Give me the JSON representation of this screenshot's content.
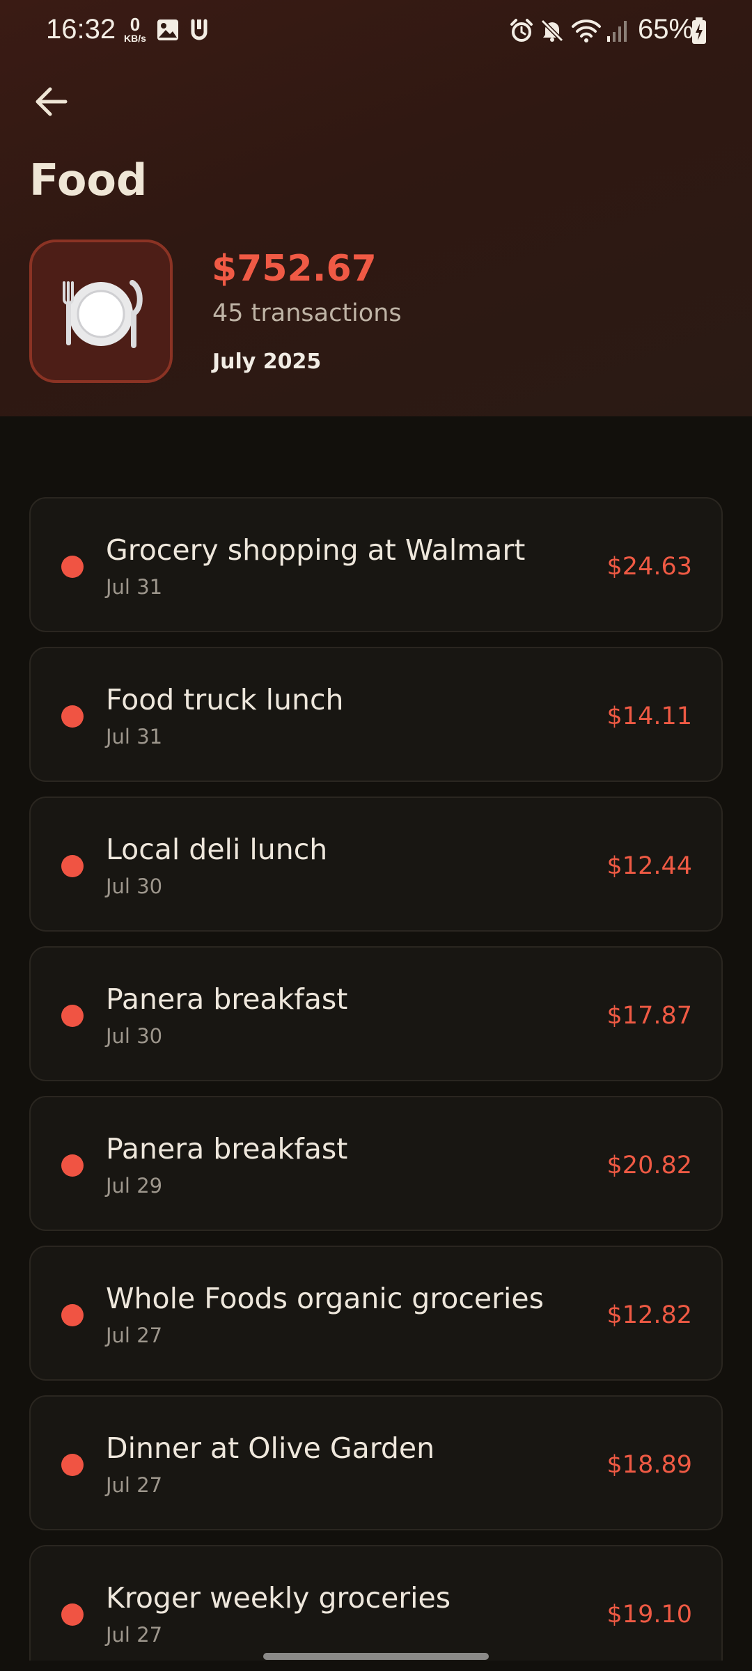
{
  "status_bar": {
    "time": "16:32",
    "net_speed_value": "0",
    "net_speed_unit": "KB/s",
    "battery": "65%",
    "icons": [
      "gallery-icon",
      "app-u-icon",
      "alarm-icon",
      "mute-icon",
      "wifi-icon",
      "signal-icon",
      "battery-charging-icon"
    ]
  },
  "header": {
    "back_icon": "arrow-left-icon",
    "title": "Food",
    "category_icon": "fork-knife-plate-icon",
    "total": "$752.67",
    "count": "45 transactions",
    "period": "July 2025"
  },
  "colors": {
    "accent_red": "#f05443",
    "header_bg": "#3a1b14",
    "page_bg": "#12100c",
    "card_bg": "#181612"
  },
  "transactions": [
    {
      "title": "Grocery shopping at Walmart",
      "date": "Jul 31",
      "amount": "$24.63"
    },
    {
      "title": "Food truck lunch",
      "date": "Jul 31",
      "amount": "$14.11"
    },
    {
      "title": "Local deli lunch",
      "date": "Jul 30",
      "amount": "$12.44"
    },
    {
      "title": "Panera breakfast",
      "date": "Jul 30",
      "amount": "$17.87"
    },
    {
      "title": "Panera breakfast",
      "date": "Jul 29",
      "amount": "$20.82"
    },
    {
      "title": "Whole Foods organic groceries",
      "date": "Jul 27",
      "amount": "$12.82"
    },
    {
      "title": "Dinner at Olive Garden",
      "date": "Jul 27",
      "amount": "$18.89"
    },
    {
      "title": "Kroger weekly groceries",
      "date": "Jul 27",
      "amount": "$19.10"
    }
  ]
}
